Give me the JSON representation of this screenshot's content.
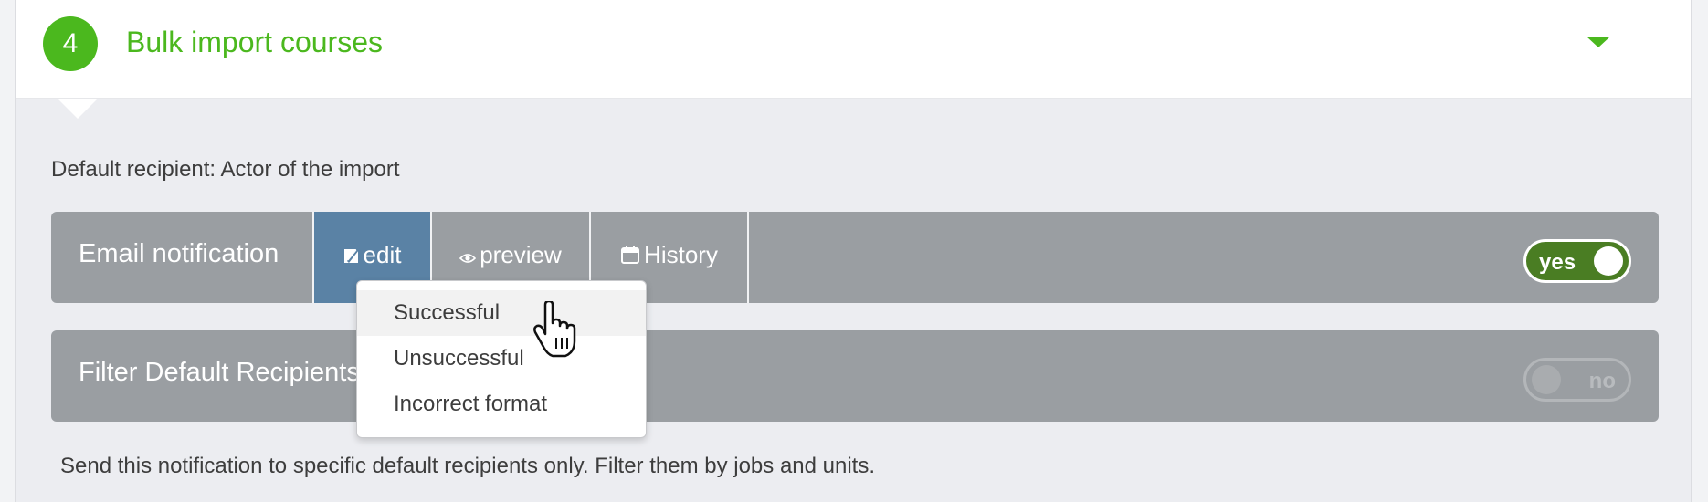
{
  "section": {
    "step_number": "4",
    "title": "Bulk import courses",
    "collapse_icon": "chevron-down-icon"
  },
  "default_recipient_text": "Default recipient: Actor of the import",
  "email_notification": {
    "label": "Email notification",
    "tabs": {
      "edit": "edit",
      "preview": "preview",
      "history": "History"
    },
    "toggle_label": "yes",
    "toggle_on": true
  },
  "dropdown": {
    "items": [
      "Successful",
      "Unsuccessful",
      "Incorrect format"
    ],
    "hovered_index": 0
  },
  "filter_default_recipients": {
    "label": "Filter Default Recipients",
    "toggle_label": "no",
    "toggle_on": false,
    "description": "Send this notification to specific default recipients only. Filter them by jobs and units."
  },
  "colors": {
    "accent_green": "#4bb81e",
    "toggle_on": "#4a7d23",
    "tab_active": "#5a82a5",
    "bar_gray": "#9a9ea2"
  }
}
